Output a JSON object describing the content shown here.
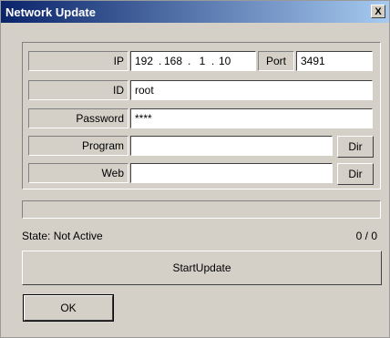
{
  "window": {
    "title": "Network Update",
    "close_label": "X"
  },
  "form": {
    "ip_label": "IP",
    "ip_parts": [
      "192",
      "168",
      "1",
      "10"
    ],
    "ip_dot": ".",
    "port_label": "Port",
    "port_value": "3491",
    "id_label": "ID",
    "id_value": "root",
    "password_label": "Password",
    "password_value": "****",
    "program_label": "Program",
    "program_value": "",
    "web_label": "Web",
    "web_value": "",
    "dir_label": "Dir"
  },
  "progress": {
    "fraction": 0
  },
  "status": {
    "state_text": "State: Not Active",
    "count_text": "0 / 0"
  },
  "actions": {
    "start_label": "StartUpdate",
    "ok_label": "OK"
  }
}
